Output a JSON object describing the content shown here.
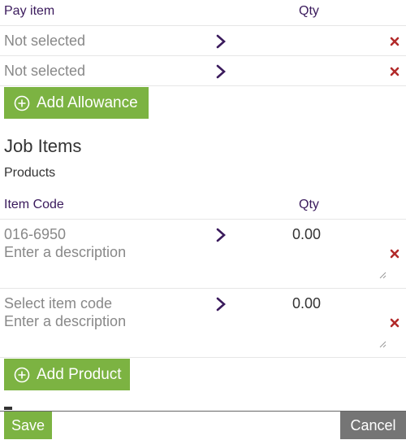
{
  "allowances": {
    "header_item": "Pay item",
    "header_qty": "Qty",
    "rows": [
      {
        "item": "Not selected"
      },
      {
        "item": "Not selected"
      }
    ],
    "add_label": "Add Allowance"
  },
  "job_items": {
    "title": "Job Items",
    "subtitle": "Products",
    "header_code": "Item Code",
    "header_qty": "Qty",
    "rows": [
      {
        "code": "016-6950",
        "qty": "0.00",
        "description_placeholder": "Enter a description"
      },
      {
        "code": "Select item code",
        "qty": "0.00",
        "description_placeholder": "Enter a description"
      }
    ],
    "add_label": "Add Product"
  },
  "footer": {
    "save_label": "Save",
    "cancel_label": "Cancel"
  },
  "colors": {
    "accent_green": "#7cb342",
    "header_purple": "#3a1a5c",
    "delete_red": "#b22a2a",
    "cancel_gray": "#757575"
  },
  "icons": {
    "chevron": "chevron-right-icon",
    "delete": "close-icon",
    "add": "plus-circle-icon"
  }
}
